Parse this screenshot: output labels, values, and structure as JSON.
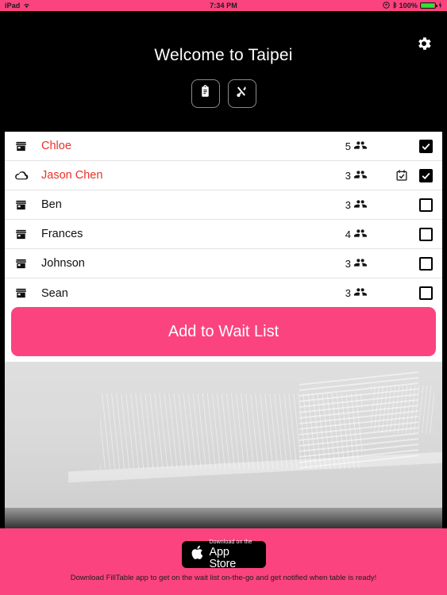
{
  "statusbar": {
    "device": "iPad",
    "wifi_icon": "wifi-icon",
    "time": "7:34 PM",
    "rotation_lock_icon": "rotation-lock-icon",
    "bluetooth_icon": "bluetooth-icon",
    "battery_percent": "100%",
    "battery_icon": "battery-full-icon",
    "charging_icon": "charging-bolt-icon"
  },
  "header": {
    "title": "Welcome to Taipei",
    "settings_icon": "gear-icon",
    "buttons": [
      {
        "name": "waitlist-button",
        "icon": "clipboard-icon"
      },
      {
        "name": "menu-button",
        "icon": "fork-spoon-icon"
      }
    ]
  },
  "waitlist": {
    "rows": [
      {
        "source_icon": "store-icon",
        "name": "Chloe",
        "party_size": "5",
        "party_icon": "people-icon",
        "reservation_icon": "",
        "checked": true
      },
      {
        "source_icon": "cloud-icon",
        "name": "Jason Chen",
        "party_size": "3",
        "party_icon": "people-icon",
        "reservation_icon": "calendar-check-icon",
        "checked": true
      },
      {
        "source_icon": "store-icon",
        "name": "Ben",
        "party_size": "3",
        "party_icon": "people-icon",
        "reservation_icon": "",
        "checked": false
      },
      {
        "source_icon": "store-icon",
        "name": "Frances",
        "party_size": "4",
        "party_icon": "people-icon",
        "reservation_icon": "",
        "checked": false
      },
      {
        "source_icon": "store-icon",
        "name": "Johnson",
        "party_size": "3",
        "party_icon": "people-icon",
        "reservation_icon": "",
        "checked": false
      },
      {
        "source_icon": "store-icon",
        "name": "Sean",
        "party_size": "3",
        "party_icon": "people-icon",
        "reservation_icon": "",
        "checked": false
      }
    ],
    "highlighted_names": [
      "Chloe",
      "Jason Chen"
    ]
  },
  "cta": {
    "label": "Add to Wait List"
  },
  "footer": {
    "appstore_small_text": "Download on the",
    "appstore_large_text": "App Store",
    "apple_icon": "apple-logo-icon",
    "note": "Download FillTable app to get on the wait list on-the-go and get notified when table is ready!"
  },
  "colors": {
    "accent_pink": "#fb447f",
    "highlight_red": "#e8312a",
    "dark": "#000000",
    "card_bg": "#ffffff"
  }
}
